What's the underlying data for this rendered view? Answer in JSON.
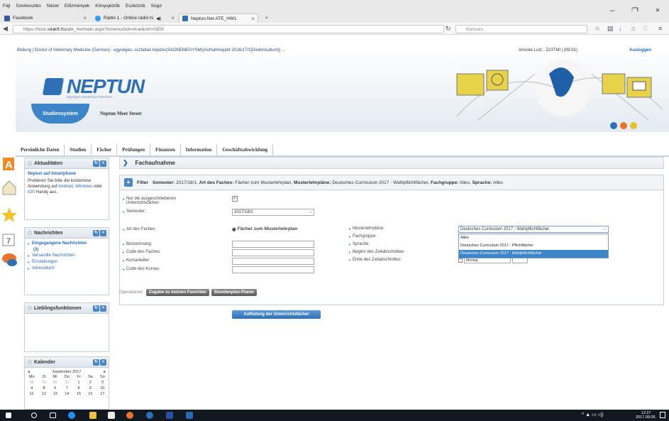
{
  "menubar": [
    "Fájl",
    "Szerkesztés",
    "Nézet",
    "Előzmények",
    "Könyvjelzők",
    "Eszközök",
    "Súgó"
  ],
  "tabs": [
    {
      "label": "Facebook",
      "color": "#3b5998"
    },
    {
      "label": "Rádió 1 - Online rádió hi",
      "color": "#2a9df4"
    },
    {
      "label": "Neptun.Net ATE_HW1",
      "color": "#2f6fb5"
    }
  ],
  "url": {
    "prefix": "https://host.",
    "domain": "sdakft.hu",
    "path": "/ate_hw/main.aspx?ismenuclick=true&ctrl=0303"
  },
  "search": {
    "placeholder": "Keresés"
  },
  "info": {
    "left": "Bildung | Doctor of Veterinary Medicine (German) - egységes, osztatlan képzés(SAONEMEGYSM)(Aufnahmejahr:2016/17/1[Direktstudium]) ...",
    "user": "Arnicke Lutz - Z23TMI | (09:31)",
    "logout": "Ausloggen"
  },
  "header": {
    "logo": "NEPTUN",
    "logo_sub": "Egységes Tanulmányi Rendszer",
    "system_button": "Studiensystem",
    "meet_street": "Neptun Meet Street"
  },
  "mainnav": [
    "Persönliche Daten",
    "Studien",
    "Fächer",
    "Prüfungen",
    "Finanzen",
    "Information",
    "Geschäftsabwicklung"
  ],
  "panels": {
    "aktualitaten": {
      "title": "Aktualitäten",
      "headline": "Neptun auf Smartphone",
      "text1": "Probieren Sie bitte die kostenlose Anwendung auf ",
      "android": "Android",
      "comma": ", ",
      "windows": "Windows",
      "text2": " oder ",
      "ios": "iOS",
      "text3": " Handy aus."
    },
    "nachrichten": {
      "title": "Nachrichten",
      "items": [
        "Eingegangene Nachrichten",
        "(3)",
        "Versandte Nachrichten",
        "Einstellungen",
        "Adressbuch"
      ]
    },
    "lieblings": {
      "title": "Lieblingsfunktionen"
    },
    "kalender": {
      "title": "Kalender",
      "month": "September 2017",
      "prev": "◂",
      "next": "▸",
      "days": [
        "Mo",
        "Di",
        "Mi",
        "Do",
        "Fr",
        "Sa",
        "So"
      ],
      "weeks": [
        [
          "28",
          "29",
          "30",
          "31",
          "1",
          "2",
          "3"
        ],
        [
          "4",
          "5",
          "6",
          "7",
          "8",
          "9",
          "10"
        ],
        [
          "11",
          "12",
          "13",
          "14",
          "15",
          "16",
          "17"
        ]
      ]
    }
  },
  "content": {
    "title": "Fachaufnahme",
    "filter": {
      "label": "Filter",
      "semester_key": "Semester:",
      "semester_val": " 2017/18/1, ",
      "art_key": "Art des Faches:",
      "art_val": " Fächer zum Musterlehrplan, ",
      "muster_key": "Musterlehrpläne:",
      "muster_val": " Deutsches Curriculum 2017 - Wahlpflichtfächer, ",
      "gruppe_key": "Fachgruppe:",
      "gruppe_val": " Alles, ",
      "sprache_key": "Sprache:",
      "sprache_val": " Alles"
    },
    "form": {
      "only_announced": "Nur die ausgeschriebenen Unterrichtsfächer:",
      "semester": "Semester:",
      "semester_value": "2017/18/1",
      "art": "Art des Faches:",
      "art_option": "Fächer zum Musterlehrplan",
      "bezeichnung": "Bezeichnung:",
      "code": "Code des Faches:",
      "kursanleiter": "Kursanleiter:",
      "kurscode": "Code des Kurses:",
      "musterlehrplane": "Musterlehrpläne:",
      "fachgruppe": "Fachgruppe:",
      "sprache": "Sprache:",
      "beginn": "Beginn des Zeitabschnittes:",
      "ende": "Ende des Zeitabschnittes:",
      "muster_value": "Deutsches Curriculum 2017 - Wahlpflichtfächer",
      "ende_value": "Montag",
      "list_button": "Auflistung der Unterrichtsfächer"
    },
    "dropdown": [
      "Alles",
      "Deutsches Curriculum 2017 - Pflichtfächer",
      "Deutsches Curriculum 2017 - Wahlpflichtfächer"
    ],
    "ops": {
      "label": "Operationen:",
      "fav": "Zugabe zu meinen Favoriten",
      "plan": "Stundenplan-Planer"
    }
  },
  "taskbar": {
    "time": "12:27",
    "date": "2017.09.05."
  }
}
